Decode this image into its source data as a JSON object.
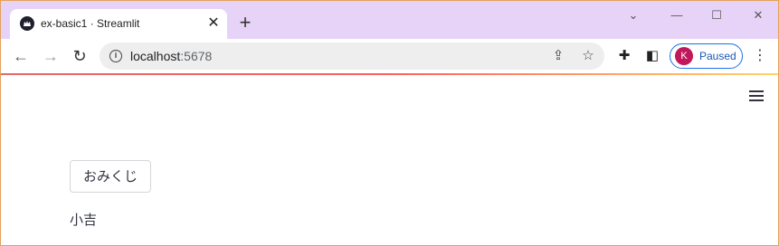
{
  "browser": {
    "tab_title": "ex-basic1 · Streamlit",
    "tab_close_icon": "close-icon",
    "new_tab_label": "+",
    "url_host": "localhost",
    "url_port": ":5678",
    "profile_initial": "K",
    "profile_status": "Paused",
    "colors": {
      "titlebar": "#e8d3f8",
      "profile_border": "#1a73e8",
      "avatar": "#c2185b"
    }
  },
  "app": {
    "button_label": "おみくじ",
    "result_text": "小吉",
    "menu_icon": "hamburger-icon"
  }
}
